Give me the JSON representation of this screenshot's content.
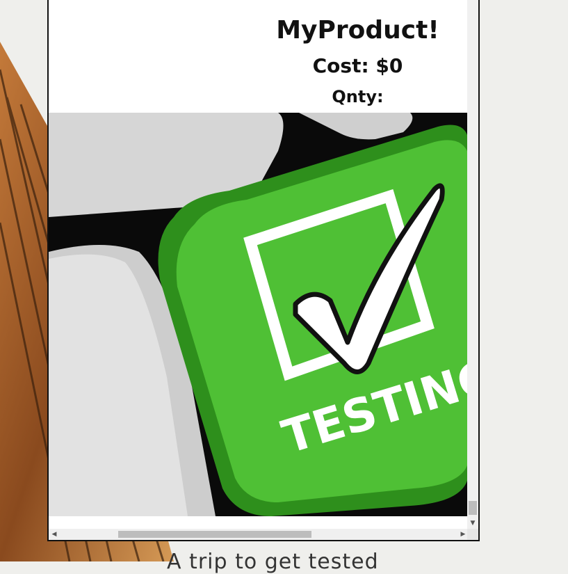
{
  "product": {
    "title": "MyProduct!",
    "cost": "Cost: $0",
    "qnty": "Qnty:"
  },
  "image": {
    "key_label": "TESTING",
    "accent_color": "#3fae2a"
  },
  "caption": "A trip to get tested",
  "scrollbars": {
    "up_arrow": "▲",
    "down_arrow": "▼",
    "left_arrow": "◀",
    "right_arrow": "▶"
  }
}
